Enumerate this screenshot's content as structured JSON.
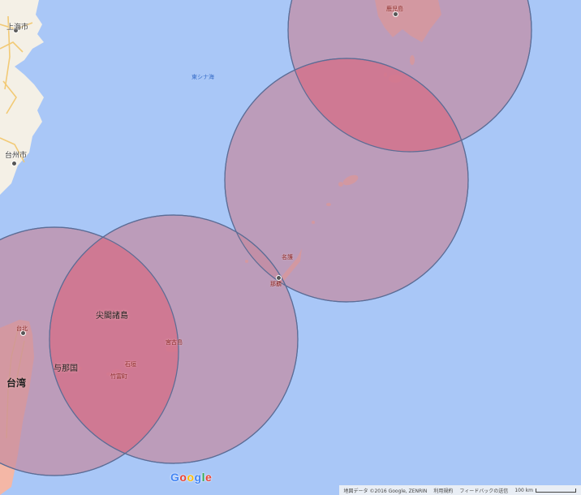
{
  "labels": {
    "shanghai": "上海市",
    "taizhou": "台州市",
    "east_china_sea": "東シナ海",
    "kagoshima": "鹿児島",
    "nago": "名護",
    "naha": "那覇",
    "taipei": "台北",
    "taiwan": "台湾",
    "senkaku": "尖閣諸島",
    "yonaguni": "与那国",
    "miyako": "宮古島",
    "ishigaki": "石垣",
    "taketomi": "竹富町"
  },
  "branding": {
    "logo_text": "Google"
  },
  "footer": {
    "map_data": "地図データ ©2016 Google, ZENRIN",
    "terms": "利用規約",
    "feedback": "フィードバックの送信",
    "scale_label": "100 km"
  },
  "colors": {
    "sea": "#a9c7f7",
    "land": "#f4f0e6",
    "circle_fill": "#c58aa0",
    "overlap_fill": "#d76f86",
    "circle_stroke": "#5c6d96"
  }
}
